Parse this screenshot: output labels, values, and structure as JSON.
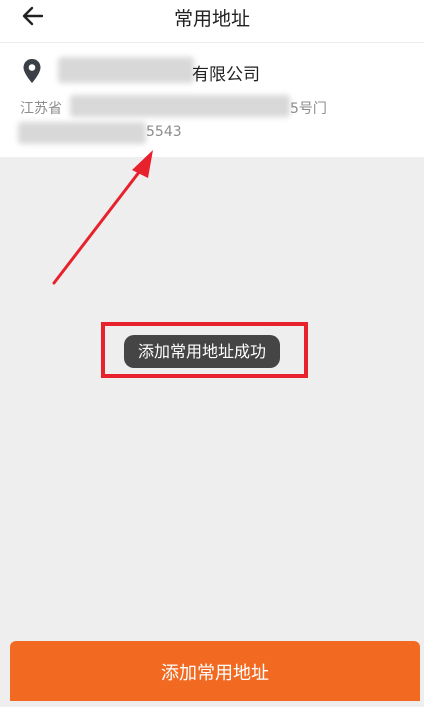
{
  "header": {
    "title": "常用地址",
    "back_icon": "arrow-left-icon"
  },
  "address": {
    "company_suffix": "有限公司",
    "line_prefix": "江苏省",
    "line_suffix": "5号门",
    "phone_suffix": "5543",
    "pin_icon": "location-pin-icon"
  },
  "toast": {
    "message": "添加常用地址成功"
  },
  "footer": {
    "add_button_label": "添加常用地址"
  },
  "colors": {
    "accent": "#f26a21",
    "annotation_red": "#e8222d",
    "toast_bg": "#454545",
    "page_bg": "#efeeee"
  }
}
